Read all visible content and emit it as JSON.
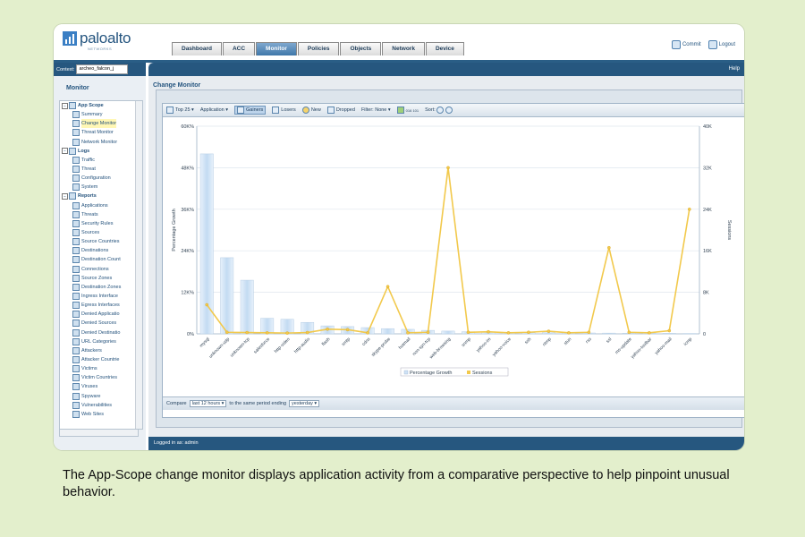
{
  "brand": {
    "name": "paloalto",
    "sub": "NETWORKS"
  },
  "tabs": [
    "Dashboard",
    "ACC",
    "Monitor",
    "Policies",
    "Objects",
    "Network",
    "Device"
  ],
  "active_tab": "Monitor",
  "top_links": {
    "commit": "Commit",
    "logout": "Logout"
  },
  "context": {
    "label": "Context:",
    "value": "archeo_falcon_j"
  },
  "left": {
    "title": "Monitor",
    "tree": [
      {
        "label": "App Scope",
        "cat": true
      },
      {
        "label": "Summary"
      },
      {
        "label": "Change Monitor",
        "selected": true
      },
      {
        "label": "Threat Monitor"
      },
      {
        "label": "Network Monitor"
      },
      {
        "label": "Logs",
        "cat": true
      },
      {
        "label": "Traffic"
      },
      {
        "label": "Threat"
      },
      {
        "label": "Configuration"
      },
      {
        "label": "System"
      },
      {
        "label": "Reports",
        "cat": true
      },
      {
        "label": "Applications"
      },
      {
        "label": "Threats"
      },
      {
        "label": "Security Rules"
      },
      {
        "label": "Sources"
      },
      {
        "label": "Source Countries"
      },
      {
        "label": "Destinations"
      },
      {
        "label": "Destination Count"
      },
      {
        "label": "Connections"
      },
      {
        "label": "Source Zones"
      },
      {
        "label": "Destination Zones"
      },
      {
        "label": "Ingress Interface"
      },
      {
        "label": "Egress Interfaces"
      },
      {
        "label": "Denied Applicatio"
      },
      {
        "label": "Denied Sources"
      },
      {
        "label": "Denied Destinatio"
      },
      {
        "label": "URL Categories"
      },
      {
        "label": "Attackers"
      },
      {
        "label": "Attacker Countrie"
      },
      {
        "label": "Victims"
      },
      {
        "label": "Victim Countries"
      },
      {
        "label": "Viruses"
      },
      {
        "label": "Spyware"
      },
      {
        "label": "Vulnerabilities"
      },
      {
        "label": "Web Sites"
      }
    ]
  },
  "main": {
    "help": "Help",
    "title": "Change Monitor"
  },
  "toolbar": {
    "top": "Top 25",
    "by": "Application",
    "gainers": "Gainers",
    "losers": "Losers",
    "new": "New",
    "dropped": "Dropped",
    "filter_label": "Filter:",
    "filter_value": "None",
    "count": "016 101",
    "sort_label": "Sort:"
  },
  "compare": {
    "label": "Compare",
    "period": "last 12 hours",
    "middle": "to the same period ending",
    "ending": "yesterday"
  },
  "status": "Logged in as: admin",
  "caption": "The App-Scope change monitor displays application activity from a comparative perspective to help pinpoint unusual behavior.",
  "chart_data": {
    "type": "bar+line",
    "categories": [
      "mysql",
      "unknown-udp",
      "unknown-tcp",
      "salesforce",
      "http-video",
      "http-audio",
      "flash",
      "smtp",
      "cdns",
      "skype-probe",
      "hotmail",
      "non-syn-tcp",
      "web-browsing",
      "snmp",
      "yahoo-im",
      "yahoo-voice",
      "ssh",
      "ntmp",
      "stun",
      "rss",
      "ssl",
      "ms-update",
      "yahoo-toolbar",
      "yahoo-mail",
      "icmp"
    ],
    "series": [
      {
        "name": "Percentage Growth",
        "type": "bar",
        "axis": "left",
        "color": "#cfe2f5",
        "values": [
          52000,
          22000,
          15500,
          4500,
          4200,
          3300,
          2300,
          2100,
          1800,
          1500,
          1300,
          1000,
          800,
          600,
          500,
          400,
          350,
          300,
          280,
          250,
          220,
          200,
          180,
          150,
          100
        ]
      },
      {
        "name": "Sessions",
        "type": "line",
        "axis": "right",
        "color": "#f2c94c",
        "values": [
          5600,
          300,
          250,
          200,
          150,
          250,
          900,
          800,
          200,
          9100,
          200,
          300,
          32000,
          300,
          400,
          200,
          300,
          500,
          200,
          300,
          16600,
          300,
          200,
          600,
          24000
        ]
      }
    ],
    "ylabel_left": "Percentage Growth",
    "ylabel_right": "Sessions",
    "yleft_ticks": [
      "0%",
      "12K%",
      "24K%",
      "36K%",
      "48K%",
      "60K%"
    ],
    "yright_ticks": [
      "0",
      "8K",
      "16K",
      "24K",
      "32K",
      "40K"
    ],
    "yleft_lim": [
      0,
      60000
    ],
    "yright_lim": [
      0,
      40000
    ],
    "legend": "bottom-center",
    "grid": true
  }
}
